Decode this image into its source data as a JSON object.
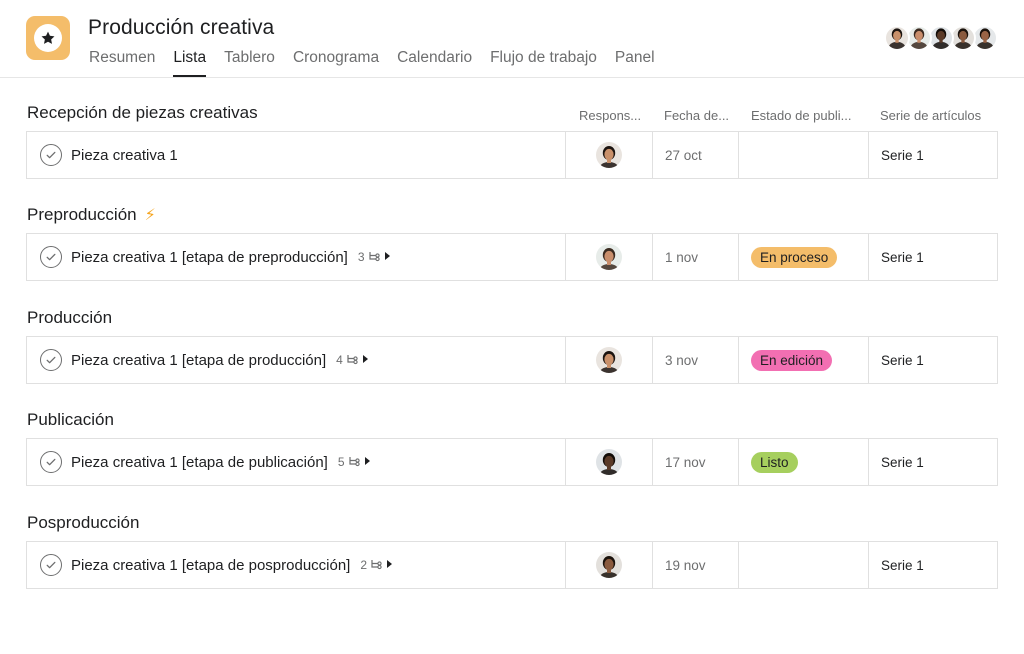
{
  "project": {
    "title": "Producción creativa",
    "icon": "star-icon",
    "icon_color": "#f4bd6a"
  },
  "tabs": [
    {
      "label": "Resumen",
      "active": false
    },
    {
      "label": "Lista",
      "active": true
    },
    {
      "label": "Tablero",
      "active": false
    },
    {
      "label": "Cronograma",
      "active": false
    },
    {
      "label": "Calendario",
      "active": false
    },
    {
      "label": "Flujo de trabajo",
      "active": false
    },
    {
      "label": "Panel",
      "active": false
    }
  ],
  "members": [
    {
      "name": "avatar-woman-long-hair",
      "skin": "#c9906a",
      "hair": "#1c1410",
      "bg": "#e9e4df"
    },
    {
      "name": "avatar-man-short-hair",
      "skin": "#c98e6c",
      "hair": "#3a2a20",
      "bg": "#e7ece9"
    },
    {
      "name": "avatar-man-dark",
      "skin": "#5a3a28",
      "hair": "#120c08",
      "bg": "#dfe3e6"
    },
    {
      "name": "avatar-man-beard",
      "skin": "#8a5a3e",
      "hair": "#1a120c",
      "bg": "#e3e0dc"
    },
    {
      "name": "avatar-man-smiling",
      "skin": "#9a6446",
      "hair": "#1a120c",
      "bg": "#e5e8ea"
    }
  ],
  "columns": {
    "assignee": "Respons...",
    "date": "Fecha de...",
    "status": "Estado de publi...",
    "series": "Serie de artículos"
  },
  "sections": [
    {
      "title": "Recepción de piezas creativas",
      "emoji": "",
      "task": {
        "name": "Pieza creativa 1",
        "subtask_count": "",
        "assignee": {
          "skin": "#c9906a",
          "hair": "#1c1410",
          "bg": "#e9e4df"
        },
        "date": "27 oct",
        "status": "",
        "status_color": "",
        "series": "Serie 1"
      }
    },
    {
      "title": "Preproducción",
      "emoji": "⚡",
      "task": {
        "name": "Pieza creativa 1 [etapa de preproducción]",
        "subtask_count": "3",
        "assignee": {
          "skin": "#c98e6c",
          "hair": "#3a2a20",
          "bg": "#e7ece9"
        },
        "date": "1 nov",
        "status": "En proceso",
        "status_color": "#f4bd6a",
        "series": "Serie 1"
      }
    },
    {
      "title": "Producción",
      "emoji": "",
      "task": {
        "name": "Pieza creativa 1 [etapa de producción]",
        "subtask_count": "4",
        "assignee": {
          "skin": "#c9906a",
          "hair": "#1c1410",
          "bg": "#e9e4df"
        },
        "date": "3 nov",
        "status": "En edición",
        "status_color": "#f26fb2",
        "series": "Serie 1"
      }
    },
    {
      "title": "Publicación",
      "emoji": "",
      "task": {
        "name": "Pieza creativa 1 [etapa de publicación]",
        "subtask_count": "5",
        "assignee": {
          "skin": "#5a3a28",
          "hair": "#120c08",
          "bg": "#dfe3e6"
        },
        "date": "17 nov",
        "status": "Listo",
        "status_color": "#a6cf5e",
        "series": "Serie 1"
      }
    },
    {
      "title": "Posproducción",
      "emoji": "",
      "task": {
        "name": "Pieza creativa 1 [etapa de posproducción]",
        "subtask_count": "2",
        "assignee": {
          "skin": "#8a5a3e",
          "hair": "#1a120c",
          "bg": "#e3e0dc"
        },
        "date": "19 nov",
        "status": "",
        "status_color": "",
        "series": "Serie 1"
      }
    }
  ]
}
